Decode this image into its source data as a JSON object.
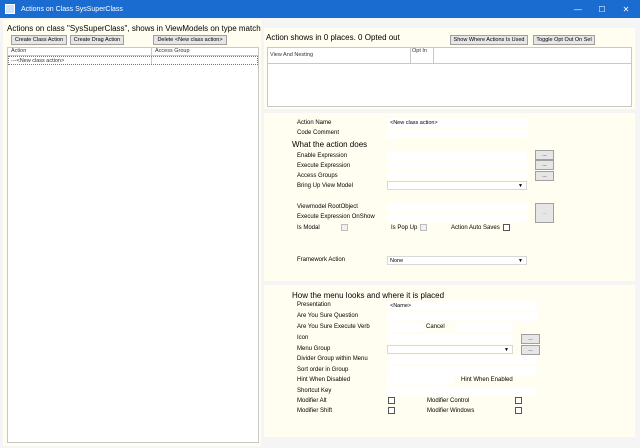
{
  "window": {
    "title": "Actions on Class SysSuperClass",
    "minimize": "—",
    "maximize": "☐",
    "close": "✕"
  },
  "left": {
    "heading": "Actions on class \"SysSuperClass\", shows in ViewModels on type match",
    "buttons": {
      "create_class_action": "Create Class Action",
      "create_drag_action": "Create Drag Action",
      "delete_action": "Delete <New class action>"
    },
    "columns": [
      "Action",
      "Access Group"
    ],
    "rows": [
      {
        "action": "---<New class action>",
        "access_group": ""
      }
    ]
  },
  "top_right": {
    "heading": "Action shows in 0 places. 0 Opted out",
    "buttons": {
      "show_where_used": "Show Where Actions Is Used",
      "toggle_opt_out": "Toggle Opt Out On Sel"
    },
    "columns": [
      "View And Nesting",
      "Opt In"
    ]
  },
  "action": {
    "name_label": "Action Name",
    "name_value": "<New class action>",
    "comment_label": "Code Comment",
    "section_heading": "What the action does",
    "enable_expression": "Enable Expression",
    "execute_expression": "Execute Expression",
    "access_groups": "Access Groups",
    "bring_up_view_model": "Bring Up View Model",
    "viewmodel_root_object": "Viewmodel RootObject",
    "execute_expression_onshow": "Execute Expression OnShow",
    "is_modal": "Is Modal",
    "is_popup": "Is Pop Up",
    "action_auto_saves": "Action Auto Saves",
    "framework_action": "Framework Action",
    "framework_action_value": "None",
    "ellipsis": "..."
  },
  "menu": {
    "section_heading": "How the menu looks and where it is placed",
    "presentation": "Presentation",
    "presentation_value": "<Name>",
    "are_you_sure_question": "Are You Sure Question",
    "are_you_sure_execute_verb": "Are You Sure Execute Verb",
    "cancel": "Cancel",
    "icon": "Icon",
    "menu_group": "Menu Group",
    "divider_group": "Divider Group within Menu",
    "sort_order": "Sort order in Group",
    "hint_when_disabled": "Hint When Disabled",
    "hint_when_enabled": "Hint When Enabled",
    "shortcut_key": "Shortcut Key",
    "modifier_alt": "Modifier Alt",
    "modifier_control": "Modifier Control",
    "modifier_shift": "Modifier Shift",
    "modifier_windows": "Modifier Windows",
    "ellipsis": "..."
  }
}
